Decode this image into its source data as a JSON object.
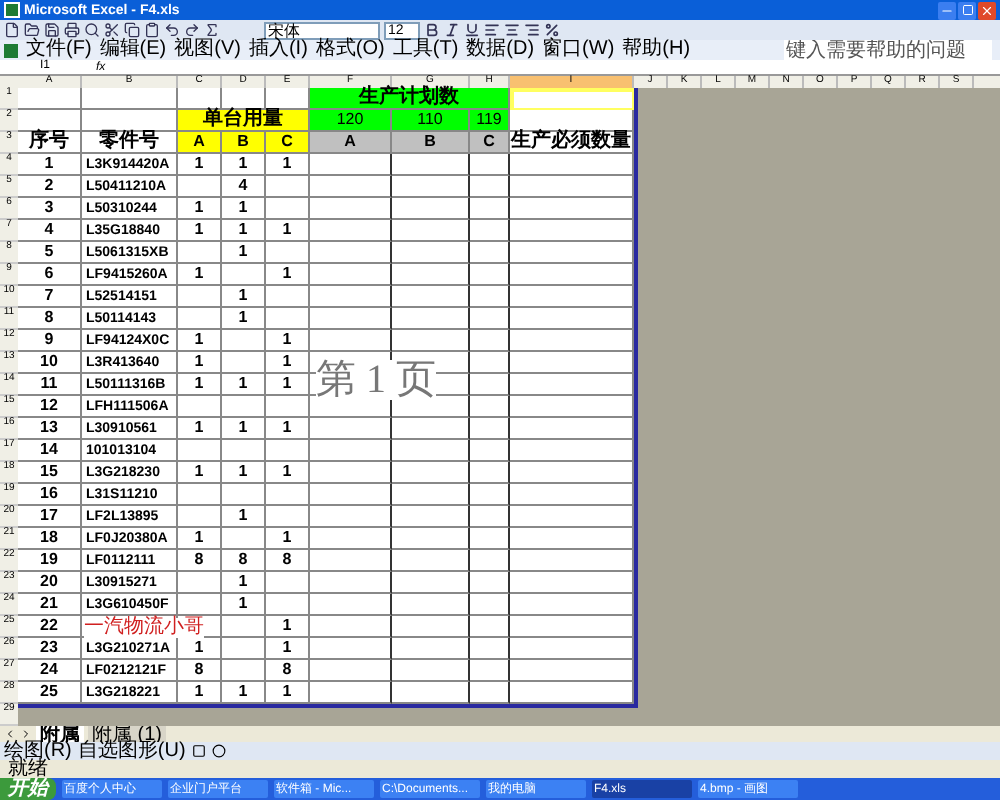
{
  "window": {
    "title": "Microsoft Excel - F4.xls"
  },
  "toolbar": {
    "font": "宋体",
    "size": "12"
  },
  "menu": [
    "文件(F)",
    "编辑(E)",
    "视图(V)",
    "插入(I)",
    "格式(O)",
    "工具(T)",
    "数据(D)",
    "窗口(W)",
    "帮助(H)"
  ],
  "help_box": {
    "placeholder": "键入需要帮助的问题"
  },
  "formula_bar": {
    "name_box": "I1",
    "fx": "fx"
  },
  "column_headers": [
    "A",
    "B",
    "C",
    "D",
    "E",
    "F",
    "G",
    "H",
    "I",
    "J",
    "K",
    "L",
    "M",
    "N",
    "O",
    "P",
    "Q",
    "R",
    "S"
  ],
  "sheet": {
    "plan_title": "生产计划数",
    "usage_title": "单台用量",
    "plan_quantities": [
      "120",
      "110",
      "119"
    ],
    "headers": {
      "seq": "序号",
      "part": "零件号",
      "usage": [
        "A",
        "B",
        "C"
      ],
      "plan": [
        "A",
        "B",
        "C"
      ],
      "required": "生产必须数量"
    },
    "rows": [
      {
        "seq": "1",
        "part": "L3K914420A",
        "usage": {
          "a": "1",
          "b": "1",
          "c": "1"
        }
      },
      {
        "seq": "2",
        "part": "L50411210A",
        "usage": {
          "b": "4"
        }
      },
      {
        "seq": "3",
        "part": "L50310244",
        "usage": {
          "a": "1",
          "b": "1"
        }
      },
      {
        "seq": "4",
        "part": "L35G18840",
        "usage": {
          "a": "1",
          "b": "1",
          "c": "1"
        }
      },
      {
        "seq": "5",
        "part": "L5061315XB",
        "usage": {
          "b": "1"
        }
      },
      {
        "seq": "6",
        "part": "LF9415260A",
        "usage": {
          "a": "1",
          "c": "1"
        }
      },
      {
        "seq": "7",
        "part": "L52514151",
        "usage": {
          "b": "1"
        }
      },
      {
        "seq": "8",
        "part": "L50114143",
        "usage": {
          "b": "1"
        }
      },
      {
        "seq": "9",
        "part": "LF94124X0C",
        "usage": {
          "a": "1",
          "c": "1"
        }
      },
      {
        "seq": "10",
        "part": "L3R413640",
        "usage": {
          "a": "1",
          "c": "1"
        }
      },
      {
        "seq": "11",
        "part": "L50111316B",
        "usage": {
          "a": "1",
          "b": "1",
          "c": "1"
        }
      },
      {
        "seq": "12",
        "part": "LFH111506A"
      },
      {
        "seq": "13",
        "part": "L30910561",
        "usage": {
          "a": "1",
          "b": "1",
          "c": "1"
        }
      },
      {
        "seq": "14",
        "part": "101013104"
      },
      {
        "seq": "15",
        "part": "L3G218230",
        "usage": {
          "a": "1",
          "b": "1",
          "c": "1"
        }
      },
      {
        "seq": "16",
        "part": "L31S11210"
      },
      {
        "seq": "17",
        "part": "LF2L13895",
        "usage": {
          "b": "1"
        }
      },
      {
        "seq": "18",
        "part": "LF0J20380A",
        "usage": {
          "a": "1",
          "c": "1"
        }
      },
      {
        "seq": "19",
        "part": "LF0112111",
        "usage": {
          "a": "8",
          "b": "8",
          "c": "8"
        }
      },
      {
        "seq": "20",
        "part": "L30915271",
        "usage": {
          "b": "1"
        }
      },
      {
        "seq": "21",
        "part": "L3G610450F",
        "usage": {
          "b": "1"
        }
      },
      {
        "seq": "22",
        "usage": {
          "c": "1"
        }
      },
      {
        "seq": "23",
        "part": "L3G210271A",
        "usage": {
          "a": "1",
          "c": "1"
        }
      },
      {
        "seq": "24",
        "part": "LF0212121F",
        "usage": {
          "a": "8",
          "c": "8"
        }
      },
      {
        "seq": "25",
        "part": "L3G218221",
        "usage": {
          "a": "1",
          "b": "1",
          "c": "1"
        }
      }
    ]
  },
  "row_headers": [
    "1",
    "2",
    "3",
    "4",
    "5",
    "6",
    "7",
    "8",
    "9",
    "10",
    "11",
    "12",
    "13",
    "14",
    "15",
    "16",
    "17",
    "18",
    "19",
    "20",
    "21",
    "22",
    "23",
    "24",
    "25",
    "26",
    "27",
    "28",
    "29"
  ],
  "page_label": "第 1 页",
  "overlay_text": "一汽物流小哥",
  "sheet_tabs": [
    {
      "label": "附属",
      "selected": true
    },
    {
      "label": "附属 (1)",
      "selected": false
    }
  ],
  "drawing_toolbar": {
    "draw": "绘图(R)",
    "autoshapes": "自选图形(U)"
  },
  "status": "就绪",
  "taskbar": {
    "start": "开始",
    "items": [
      {
        "label": "百度个人中心",
        "selected": false
      },
      {
        "label": "企业门户平台",
        "selected": false
      },
      {
        "label": "软件箱 - Mic...",
        "selected": false
      },
      {
        "label": "C:\\Documents...",
        "selected": false
      },
      {
        "label": "我的电脑",
        "selected": false
      },
      {
        "label": "F4.xls",
        "selected": true
      },
      {
        "label": "4.bmp - 画图",
        "selected": false
      }
    ]
  }
}
